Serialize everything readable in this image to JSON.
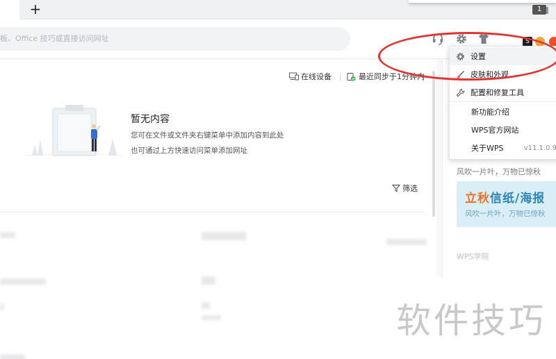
{
  "tabs": {
    "add_label": "+",
    "window_count": "1"
  },
  "toolbar": {
    "search_placeholder": "板、Office 技巧或直接访问网址",
    "avatar_text": "S",
    "colors": {
      "accent": "#e8742a"
    }
  },
  "sync": {
    "online_devices": "在线设备",
    "last_sync": "最近同步于1分钟内"
  },
  "empty_state": {
    "title": "暂无内容",
    "desc_line1": "您可在文件或文件夹右键菜单中添加内容到此处",
    "desc_line2": "也可通过上方快速访问菜单添加网址"
  },
  "filter": {
    "label": "筛选"
  },
  "right_panel": {
    "slogan": "风吹一片叶，万物已惊秋",
    "banner": {
      "title_part1": "立秋",
      "title_part2": "信纸/海报",
      "subtitle": "风吹一片叶，万物已惊秋"
    },
    "academy": "WPS学院"
  },
  "menu": {
    "items": [
      {
        "label": "设置",
        "icon": "gear-icon"
      },
      {
        "label": "皮肤和外观",
        "icon": "brush-icon"
      },
      {
        "label": "配置和修复工具",
        "icon": "wrench-icon"
      },
      {
        "label": "新功能介绍",
        "icon": ""
      },
      {
        "label": "WPS官方网站",
        "icon": ""
      },
      {
        "label": "关于WPS",
        "icon": ""
      }
    ],
    "version": "v11.1.0.9"
  },
  "watermark": {
    "text": "软件技巧"
  }
}
